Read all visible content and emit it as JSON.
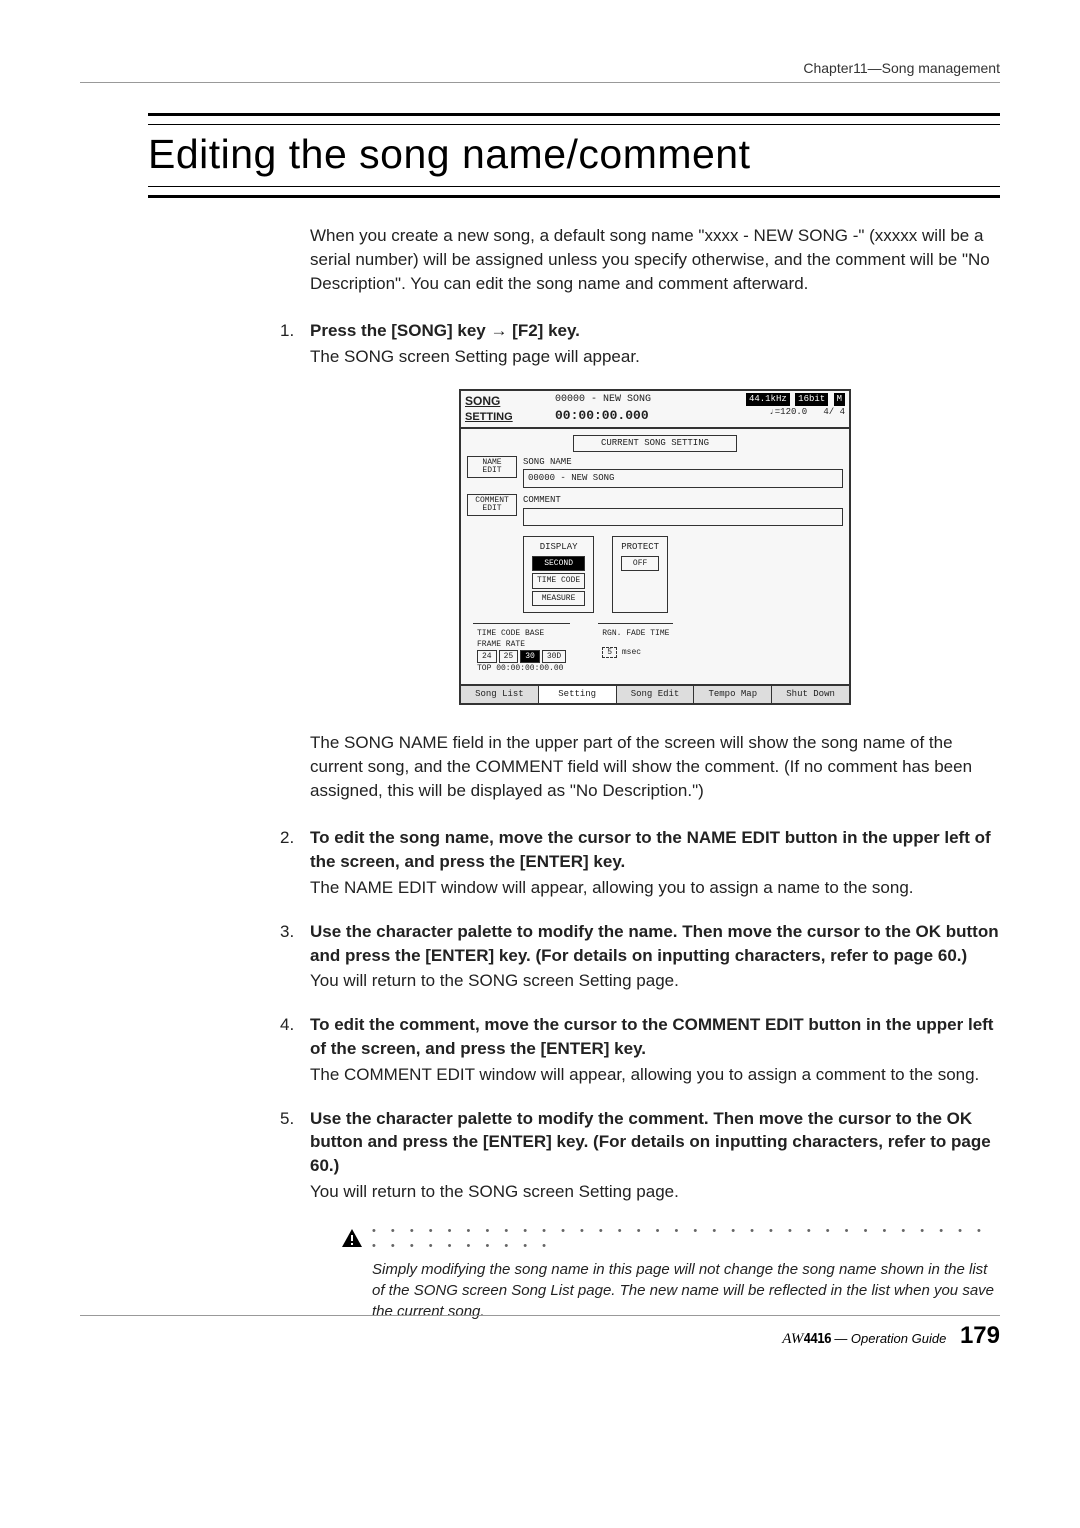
{
  "header": {
    "chapter": "Chapter11—Song management"
  },
  "title": "Editing the song name/comment",
  "intro": "When you create a new song, a default song name \"xxxx - NEW SONG -\" (xxxxx will be a serial number) will be assigned unless you specify otherwise, and the comment will be \"No Description\". You can edit the song name and comment afterward.",
  "steps": [
    {
      "num": "1.",
      "head": "Press the [SONG] key → [F2] key.",
      "desc": "The SONG screen Setting page will appear."
    },
    {
      "num": "2.",
      "head": "To edit the song name, move the cursor to the NAME EDIT button in the upper left of the screen, and press the [ENTER] key.",
      "desc": "The NAME EDIT window will appear, allowing you to assign a name to the song."
    },
    {
      "num": "3.",
      "head": "Use the character palette to modify the name. Then move the cursor to the OK button and press the [ENTER] key. (For details on inputting characters, refer to page 60.)",
      "desc": "You will return to the SONG screen Setting page."
    },
    {
      "num": "4.",
      "head": "To edit the comment, move the cursor to the COMMENT EDIT button in the upper left of the screen, and press the [ENTER] key.",
      "desc": "The COMMENT EDIT window will appear, allowing you to assign a comment to the song."
    },
    {
      "num": "5.",
      "head": "Use the character palette to modify the comment. Then move the cursor to the OK button and press the [ENTER] key. (For details on inputting characters, refer to page 60.)",
      "desc": "You will return to the SONG screen Setting page."
    }
  ],
  "after_screenshot_para": "The SONG NAME field in the upper part of the screen will show the song name of the current song, and the COMMENT field will show the comment. (If no comment has been assigned, this will be displayed as \"No Description.\")",
  "warning": {
    "dots": "• • • • • • • • • • • • • • • • • • • • • • • • • • • • • • • • • • • • • • • • • • •",
    "text": "Simply modifying the song name in this page will not change the song name shown in the list of the SONG screen Song List page. The new name will be reflected in the list when you save the current song."
  },
  "screenshot": {
    "top": {
      "title1": "SONG",
      "title2": "SETTING",
      "songline": "00000 - NEW SONG",
      "time": "00:00:00.000",
      "sr": "44.1kHz",
      "bits": "16bit",
      "tempo": "♩=120.0",
      "sig": "4/ 4",
      "icon": "M"
    },
    "section_title": "CURRENT SONG SETTING",
    "name_edit_btn": "NAME\nEDIT",
    "comment_edit_btn": "COMMENT\nEDIT",
    "song_name_label": "SONG NAME",
    "song_name_value": "00000 - NEW SONG",
    "comment_label": "COMMENT",
    "comment_value": "",
    "display_panel": {
      "title": "DISPLAY",
      "opts": [
        "SECOND",
        "TIME CODE",
        "MEASURE"
      ],
      "active": "SECOND"
    },
    "protect_panel": {
      "title": "PROTECT",
      "value": "OFF"
    },
    "timecode_panel": {
      "title": "TIME CODE BASE",
      "frame_rate_label": "FRAME RATE",
      "rates": [
        "24",
        "25",
        "30",
        "30D"
      ],
      "active": "30",
      "top_line": "TOP 00:00:00:00.00"
    },
    "fade_panel": {
      "title": "RGN. FADE TIME",
      "value": "5",
      "unit": "msec"
    },
    "tabs": [
      "Song List",
      "Setting",
      "Song Edit",
      "Tempo Map",
      "Shut Down"
    ],
    "active_tab": "Setting"
  },
  "footer": {
    "brand": "AW",
    "model": "4416",
    "guide": "— Operation Guide",
    "page": "179"
  }
}
